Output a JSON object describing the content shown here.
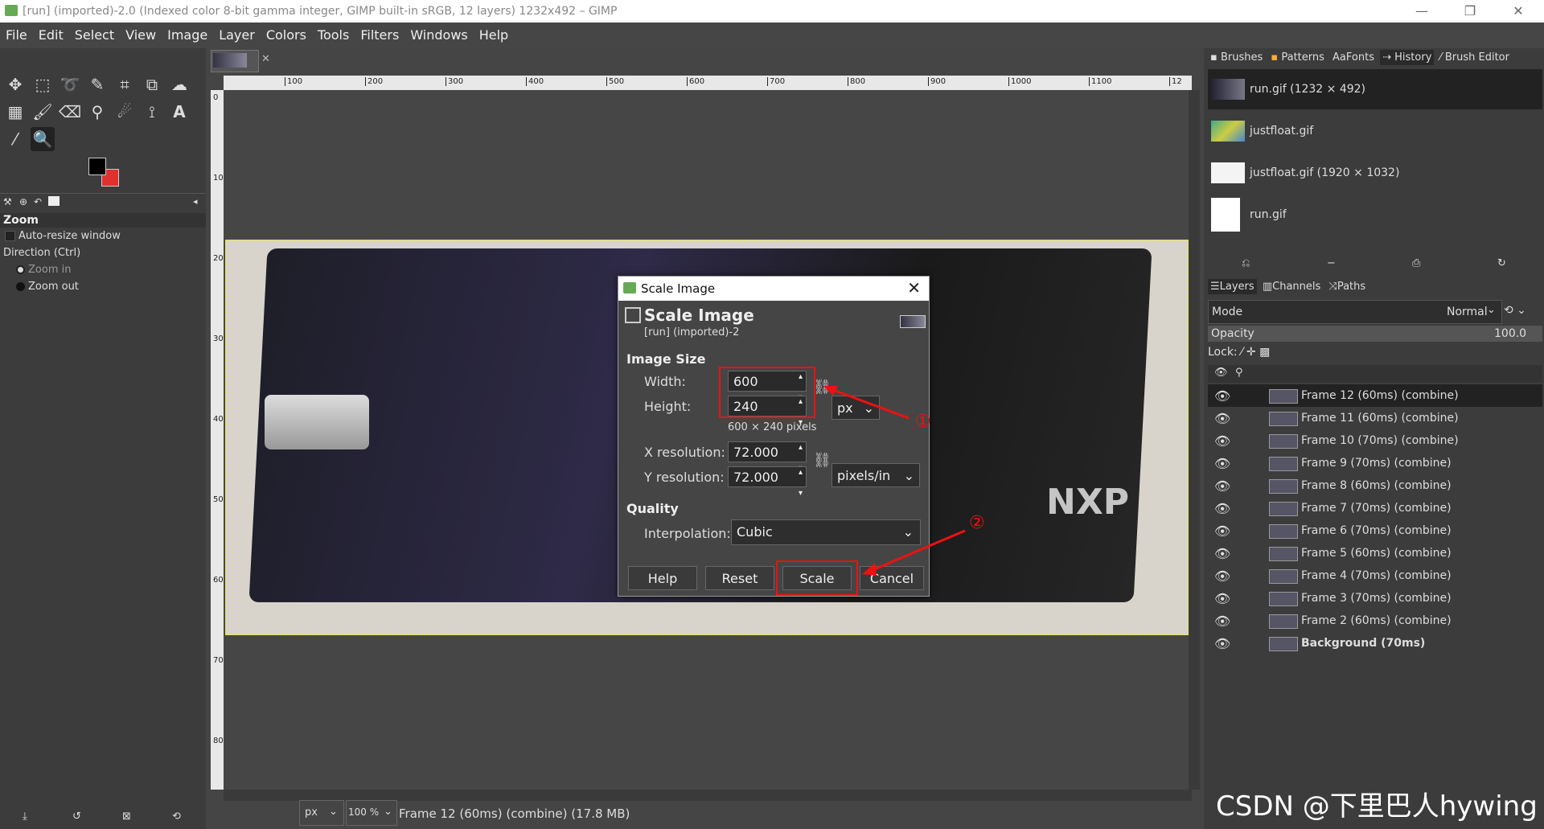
{
  "window": {
    "title": "[run] (imported)-2.0 (Indexed color 8-bit gamma integer, GIMP built-in sRGB, 12 layers) 1232x492 – GIMP"
  },
  "menu": [
    "File",
    "Edit",
    "Select",
    "View",
    "Image",
    "Layer",
    "Colors",
    "Tools",
    "Filters",
    "Windows",
    "Help"
  ],
  "tool_options": {
    "title": "Zoom",
    "auto_resize": "Auto-resize window",
    "direction_label": "Direction  (Ctrl)",
    "zoom_in": "Zoom in",
    "zoom_out": "Zoom out"
  },
  "ruler": {
    "top_ticks": [
      "100",
      "200",
      "300",
      "400",
      "500",
      "600",
      "700",
      "800",
      "900",
      "1000",
      "1100",
      "12"
    ],
    "left_ticks": [
      "0",
      "100",
      "200",
      "300",
      "400",
      "500",
      "600",
      "700",
      "800"
    ]
  },
  "status": {
    "unit": "px",
    "zoom": "100 %",
    "info": "Frame 12 (60ms) (combine) (17.8 MB)"
  },
  "dock_top_tabs": [
    "Brushes",
    "Patterns",
    "Fonts",
    "History",
    "Brush Editor"
  ],
  "history_items": [
    "run.gif (1232 × 492)",
    "justfloat.gif",
    "justfloat.gif (1920 × 1032)",
    "run.gif"
  ],
  "dock_mid_tabs": [
    "Layers",
    "Channels",
    "Paths"
  ],
  "layers_panel": {
    "mode_label": "Mode",
    "mode_value": "Normal",
    "opacity_label": "Opacity",
    "opacity_value": "100.0",
    "lock_label": "Lock:"
  },
  "layers": [
    "Frame 12 (60ms) (combine)",
    "Frame 11 (60ms) (combine)",
    "Frame 10 (70ms) (combine)",
    "Frame 9 (70ms) (combine)",
    "Frame 8 (60ms) (combine)",
    "Frame 7 (70ms) (combine)",
    "Frame 6 (70ms) (combine)",
    "Frame 5 (60ms) (combine)",
    "Frame 4 (70ms) (combine)",
    "Frame 3 (70ms) (combine)",
    "Frame 2 (60ms) (combine)",
    "Background (70ms)"
  ],
  "dialog": {
    "window_title": "Scale Image",
    "heading": "Scale Image",
    "subheading": "[run] (imported)-2",
    "image_size_label": "Image Size",
    "width_label": "Width:",
    "width_value": "600",
    "height_label": "Height:",
    "height_value": "240",
    "unit": "px",
    "pixels_note": "600 × 240 pixels",
    "xres_label": "X resolution:",
    "xres_value": "72.000",
    "yres_label": "Y resolution:",
    "yres_value": "72.000",
    "res_unit": "pixels/in",
    "quality_label": "Quality",
    "interp_label": "Interpolation:",
    "interp_value": "Cubic",
    "help": "Help",
    "reset": "Reset",
    "scale": "Scale",
    "cancel": "Cancel"
  },
  "annotations": {
    "one": "①",
    "two": "②"
  },
  "watermark": "CSDN @下里巴人hywing",
  "colors": {
    "accent_red": "#e11111",
    "fg": "#000000",
    "bg": "#e03030"
  }
}
